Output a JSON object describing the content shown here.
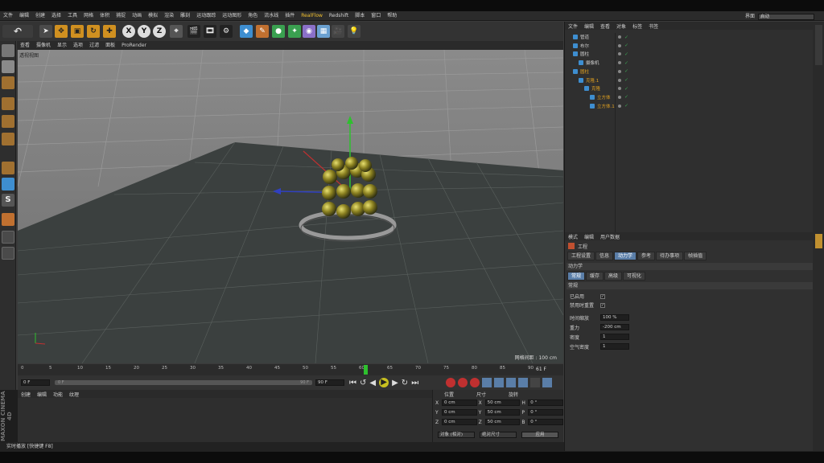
{
  "menu": [
    "文件",
    "编辑",
    "创建",
    "选择",
    "工具",
    "网格",
    "体积",
    "捕捉",
    "动画",
    "模拟",
    "渲染",
    "雕刻",
    "运动跟踪",
    "运动图形",
    "角色",
    "流水线",
    "插件",
    "RealFlow",
    "Redshift",
    "脚本",
    "窗口",
    "帮助"
  ],
  "layout": {
    "label": "界面",
    "value": "启动"
  },
  "axis_buttons": [
    "X",
    "Y",
    "Z"
  ],
  "viewport": {
    "menu": [
      "查看",
      "摄像机",
      "显示",
      "选项",
      "过滤",
      "面板",
      "ProRender"
    ],
    "camera_label": "透视视图",
    "grid_label": "网格间距 : 100 cm"
  },
  "timeline": {
    "ticks": [
      "0",
      "5",
      "10",
      "15",
      "20",
      "25",
      "30",
      "35",
      "40",
      "45",
      "50",
      "55",
      "60",
      "65",
      "70",
      "75",
      "80",
      "85",
      "90"
    ],
    "current": "61",
    "end_label": "61 F"
  },
  "transport": {
    "start": "0 F",
    "range_start": "0 F",
    "range_end": "90 F",
    "end": "90 F"
  },
  "material": {
    "menu": [
      "创建",
      "编辑",
      "功能",
      "纹理"
    ]
  },
  "coords": {
    "headers": [
      "位置",
      "尺寸",
      "旋转"
    ],
    "rows": [
      {
        "axis": "X",
        "pos": "0 cm",
        "size_axis": "X",
        "size": "50 cm",
        "rot_axis": "H",
        "rot": "0 °"
      },
      {
        "axis": "Y",
        "pos": "0 cm",
        "size_axis": "Y",
        "size": "50 cm",
        "rot_axis": "P",
        "rot": "0 °"
      },
      {
        "axis": "Z",
        "pos": "0 cm",
        "size_axis": "Z",
        "size": "50 cm",
        "rot_axis": "B",
        "rot": "0 °"
      }
    ],
    "mode": "对象 (相对)",
    "size_mode": "绝对尺寸",
    "apply": "应用"
  },
  "status": "实时播放 [快捷键 F8]",
  "objmgr": {
    "menu": [
      "文件",
      "编辑",
      "查看",
      "对象",
      "标签",
      "书签"
    ],
    "objects": [
      {
        "name": "管道",
        "indent": 0,
        "color": "#cfcfcf"
      },
      {
        "name": "布尔",
        "indent": 0,
        "color": "#cfcfcf"
      },
      {
        "name": "圆柱",
        "indent": 0,
        "color": "#cfcfcf"
      },
      {
        "name": "摄像机",
        "indent": 1,
        "color": "#cfcfcf"
      },
      {
        "name": "圆柱",
        "indent": 0,
        "color": "#e0a020"
      },
      {
        "name": "克隆.1",
        "indent": 1,
        "color": "#e0a020"
      },
      {
        "name": "克隆",
        "indent": 2,
        "color": "#e0a020"
      },
      {
        "name": "立方体",
        "indent": 3,
        "color": "#e0a020"
      },
      {
        "name": "立方体.1",
        "indent": 3,
        "color": "#e0a020"
      }
    ]
  },
  "attrmgr": {
    "menu": [
      "模式",
      "编辑",
      "用户数据"
    ],
    "title": "工程",
    "tabs": [
      "工程设置",
      "信息",
      "动力学",
      "参考",
      "待办事项",
      "帧插值"
    ],
    "active_tab": "动力学",
    "section": "动力学",
    "subtabs": [
      "常规",
      "缓存",
      "高级",
      "可视化"
    ],
    "active_subtab": "常规",
    "group": "常规",
    "checks": [
      {
        "label": "已启用",
        "checked": true
      },
      {
        "label": "禁用时重置",
        "checked": true
      }
    ],
    "fields": [
      {
        "label": "时间缩放",
        "value": "100 %"
      },
      {
        "label": "重力",
        "value": "-200 cm"
      },
      {
        "label": "密度",
        "value": "1"
      },
      {
        "label": "空气密度",
        "value": "1"
      }
    ]
  },
  "colors": {
    "accent": "#5a7ea8",
    "highlight": "#e0a020",
    "bg": "#3a3a3a"
  }
}
